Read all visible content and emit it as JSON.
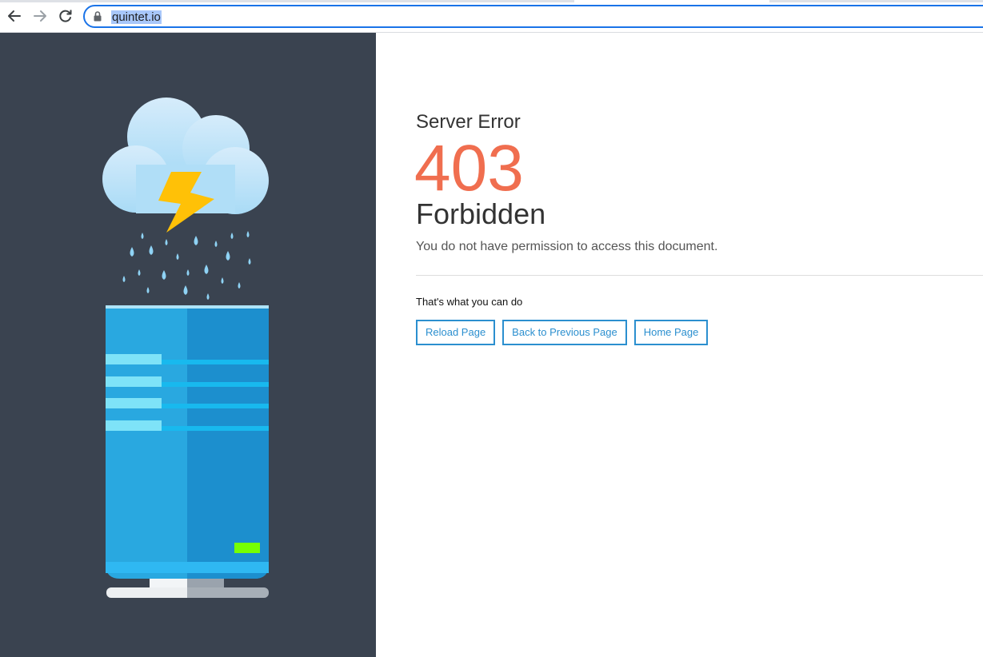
{
  "browser": {
    "url": "quintet.io",
    "back_icon": "arrow-left-icon",
    "forward_icon": "arrow-right-icon",
    "reload_icon": "reload-icon",
    "lock_icon": "lock-icon",
    "accent_color": "#1a73e8"
  },
  "error": {
    "subtitle": "Server Error",
    "code": "403",
    "reason": "Forbidden",
    "message": "You do not have permission to access this document.",
    "code_color": "#f06e4f"
  },
  "actions": {
    "hint": "That's what you can do",
    "reload_label": "Reload Page",
    "back_label": "Back to Previous Page",
    "home_label": "Home Page",
    "button_color": "#2b8fcf"
  },
  "illustration": {
    "description_icons": [
      "cloud-icon",
      "lightning-icon",
      "raindrop-icon",
      "server-icon"
    ],
    "panel_color": "#3a4350"
  }
}
